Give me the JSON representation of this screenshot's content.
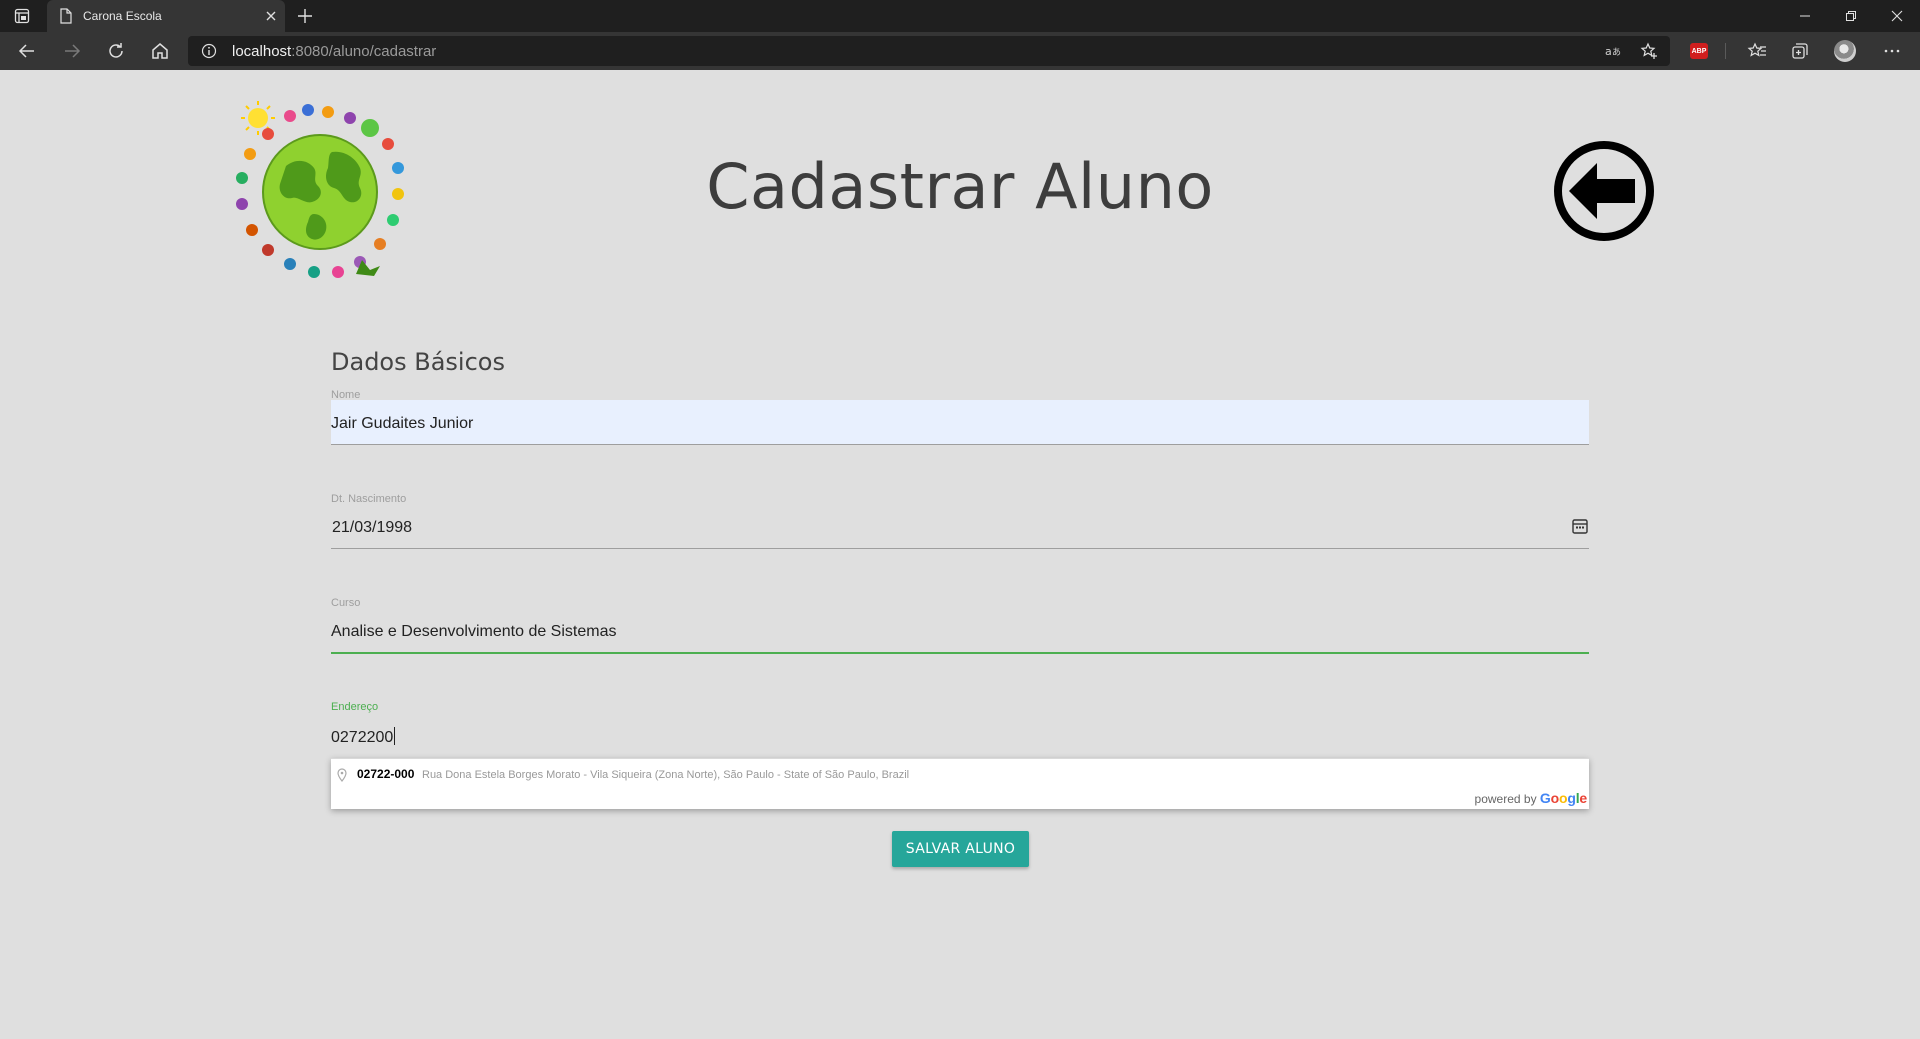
{
  "browser": {
    "tab_title": "Carona Escola",
    "url_host": "localhost",
    "url_rest": ":8080/aluno/cadastrar",
    "abp_label": "ABP",
    "icons": [
      "tab-actions-icon",
      "page-icon",
      "close-icon",
      "plus-icon",
      "minimize-icon",
      "restore-icon",
      "close-window-icon",
      "back-arrow-icon",
      "forward-arrow-icon",
      "refresh-icon",
      "home-icon",
      "info-icon",
      "read-aloud-icon",
      "favorite-add-icon",
      "adblock-icon",
      "favorites-icon",
      "collections-icon",
      "profile-avatar",
      "more-icon"
    ]
  },
  "page": {
    "title": "Cadastrar Aluno",
    "section_title": "Dados Básicos",
    "accent_color": "#26a69a",
    "valid_color": "#4caf50"
  },
  "form": {
    "nome": {
      "label": "Nome",
      "value": "Jair Gudaites Junior"
    },
    "nascimento": {
      "label": "Dt. Nascimento",
      "value": "21/03/1998"
    },
    "curso": {
      "label": "Curso",
      "value": "Analise e Desenvolvimento de Sistemas"
    },
    "endereco": {
      "label": "Endereço",
      "value": "0272200"
    }
  },
  "autocomplete": {
    "items": [
      {
        "main": "02722-000",
        "secondary": "Rua Dona Estela Borges Morato - Vila Siqueira (Zona Norte), São Paulo - State of São Paulo, Brazil"
      }
    ],
    "powered_by": "powered by",
    "brand": "Google"
  },
  "actions": {
    "save_label": "SALVAR ALUNO"
  }
}
